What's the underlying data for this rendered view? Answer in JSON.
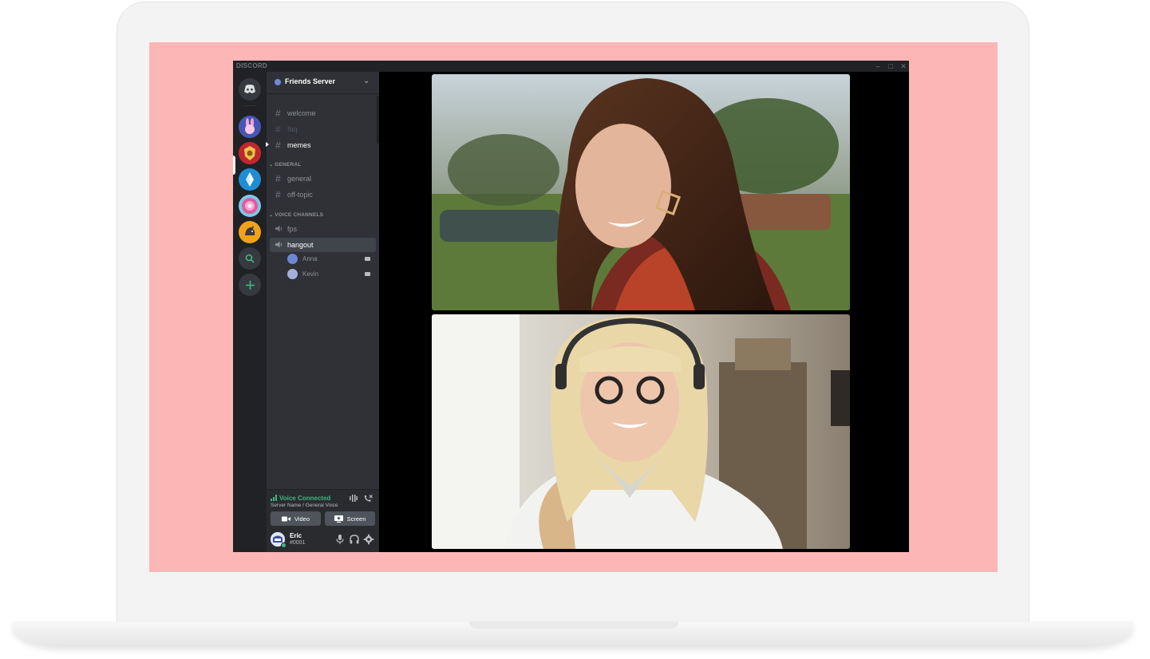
{
  "window": {
    "brand": "DISCORD"
  },
  "window_controls": [
    "minimize-icon",
    "maximize-icon",
    "close-icon"
  ],
  "server": {
    "name": "Friends Server"
  },
  "servers": [
    "home-icon",
    "bunny-server-icon",
    "lion-server-icon",
    "crystal-server-icon",
    "flower-server-icon",
    "hedgehog-server-icon",
    "explore-icon",
    "add-server-icon"
  ],
  "channels": {
    "top": [
      {
        "name": "welcome"
      },
      {
        "name": "faq"
      },
      {
        "name": "memes"
      }
    ],
    "general_category": "GENERAL",
    "general": [
      {
        "name": "general"
      },
      {
        "name": "off-topic"
      }
    ],
    "voice_category": "VOICE CHANNELS",
    "voice": [
      {
        "name": "fps"
      },
      {
        "name": "hangout"
      }
    ],
    "voice_users": [
      {
        "name": "Anna"
      },
      {
        "name": "Kevin"
      }
    ]
  },
  "voice_status": {
    "title": "Voice Connected",
    "subtitle": "Server Name / General Voice",
    "video_label": "Video",
    "screen_label": "Screen"
  },
  "user": {
    "name": "Eric",
    "tag": "#0001"
  },
  "colors": {
    "accent": "#7289da",
    "online": "#43b581",
    "sidebar": "#2f3136",
    "rail": "#202225",
    "backdrop": "#fdb6b6"
  }
}
